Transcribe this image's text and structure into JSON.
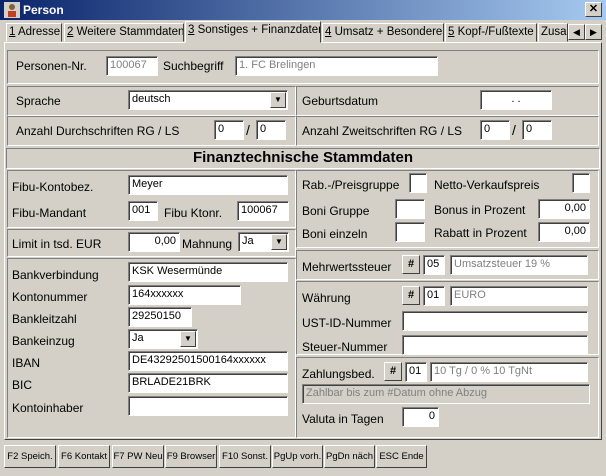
{
  "window": {
    "title": "Person",
    "close_glyph": "✕"
  },
  "tabs": [
    {
      "num": "1",
      "label": "Adresse"
    },
    {
      "num": "2",
      "label": "Weitere Stammdaten"
    },
    {
      "num": "3",
      "label": "Sonstiges + Finanzdaten"
    },
    {
      "num": "4",
      "label": "Umsatz + Besonderes"
    },
    {
      "num": "5",
      "label": "Kopf-/Fußtexte"
    },
    {
      "num": "",
      "label": "Zusa"
    }
  ],
  "header": {
    "personen_nr_label": "Personen-Nr.",
    "personen_nr_value": "100067",
    "suchbegriff_label": "Suchbegriff",
    "suchbegriff_value": "1. FC Brelingen"
  },
  "general": {
    "sprache_label": "Sprache",
    "sprache_value": "deutsch",
    "geburtsdatum_label": "Geburtsdatum",
    "geburtsdatum_value": ". .",
    "durchschriften_label": "Anzahl Durchschriften RG / LS",
    "durchschriften_rg": "0",
    "durchschriften_ls": "0",
    "zweitschriften_label": "Anzahl Zweitschriften RG / LS",
    "zweitschriften_rg": "0",
    "zweitschriften_ls": "0",
    "slash": "/"
  },
  "section_title": "Finanztechnische Stammdaten",
  "fibu": {
    "kontobez_label": "Fibu-Kontobez.",
    "kontobez_value": "Meyer",
    "mandant_label": "Fibu-Mandant",
    "mandant_value": "001",
    "ktonr_label": "Fibu Ktonr.",
    "ktonr_value": "100067",
    "limit_label": "Limit in tsd. EUR",
    "limit_value": "0,00",
    "mahnung_label": "Mahnung",
    "mahnung_value": "Ja"
  },
  "rabatt": {
    "preisgruppe_label": "Rab.-/Preisgruppe",
    "netto_label": "Netto-Verkaufspreis",
    "boni_gruppe_label": "Boni Gruppe",
    "bonus_prozent_label": "Bonus in Prozent",
    "bonus_prozent_value": "0,00",
    "boni_einzeln_label": "Boni einzeln",
    "rabatt_prozent_label": "Rabatt in Prozent",
    "rabatt_prozent_value": "0,00"
  },
  "bank": {
    "verbindung_label": "Bankverbindung",
    "verbindung_value": "KSK Wesermünde",
    "kontonummer_label": "Kontonummer",
    "kontonummer_value": "164xxxxxx",
    "blz_label": "Bankleitzahl",
    "blz_value": "29250150",
    "einzug_label": "Bankeinzug",
    "einzug_value": "Ja",
    "iban_label": "IBAN",
    "iban_value": "DE43292501500164xxxxxx",
    "bic_label": "BIC",
    "bic_value": "BRLADE21BRK",
    "inhaber_label": "Kontoinhaber",
    "inhaber_value": ""
  },
  "tax": {
    "mwst_label": "Mehrwertssteuer",
    "mwst_code": "05",
    "mwst_text": "Umsatzsteuer 19 %",
    "waehrung_label": "Währung",
    "waehrung_code": "01",
    "waehrung_text": "EURO",
    "ust_label": "UST-ID-Nummer",
    "ust_value": "",
    "steuer_label": "Steuer-Nummer",
    "steuer_value": "",
    "zahlung_label": "Zahlungsbed.",
    "zahlung_code": "01",
    "zahlung_text": "10 Tg / 0 % 10 TgNt",
    "zahlung_detail": "Zahlbar bis zum #Datum ohne Abzug",
    "valuta_label": "Valuta in Tagen",
    "valuta_value": "0",
    "hash": "#"
  },
  "function_keys": [
    "F2 Speich.",
    "F6 Kontakt",
    "F7 PW Neu",
    "F9 Browser",
    "F10 Sonst.",
    "PgUp vorh.",
    "PgDn näch",
    "ESC Ende"
  ]
}
